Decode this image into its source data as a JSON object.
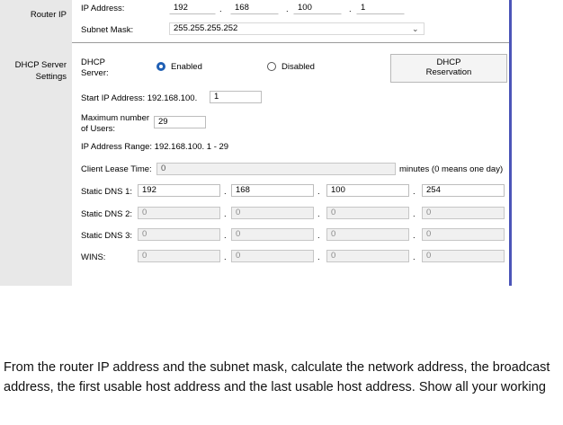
{
  "router_ip": {
    "section_label": "Router IP",
    "ip_label": "IP Address:",
    "octets": [
      "192",
      "168",
      "100",
      "1"
    ],
    "mask_label": "Subnet Mask:",
    "mask_value": "255.255.255.252"
  },
  "dhcp": {
    "section_label_1": "DHCP Server",
    "section_label_2": "Settings",
    "server_label_1": "DHCP",
    "server_label_2": "Server:",
    "enabled_label": "Enabled",
    "disabled_label": "Disabled",
    "reservation_label_1": "DHCP",
    "reservation_label_2": "Reservation",
    "start_ip_label": "Start IP Address: 192.168.100.",
    "start_ip_value": "1",
    "max_users_label_1": "Maximum number",
    "max_users_label_2": "of Users:",
    "max_users_value": "29",
    "range_text": "IP Address Range: 192.168.100. 1 - 29",
    "lease_label": "Client Lease Time:",
    "lease_value": "0",
    "lease_unit": "minutes (0 means one day)",
    "dns1_label": "Static DNS 1:",
    "dns1": [
      "192",
      "168",
      "100",
      "254"
    ],
    "dns2_label": "Static DNS 2:",
    "dns2": [
      "0",
      "0",
      "0",
      "0"
    ],
    "dns3_label": "Static DNS 3:",
    "dns3": [
      "0",
      "0",
      "0",
      "0"
    ],
    "wins_label": "WINS:",
    "wins": [
      "0",
      "0",
      "0",
      "0"
    ]
  },
  "question": "From the router IP address and the subnet mask, calculate the network address, the broadcast address, the first usable host address and the last usable host address. Show all your working"
}
